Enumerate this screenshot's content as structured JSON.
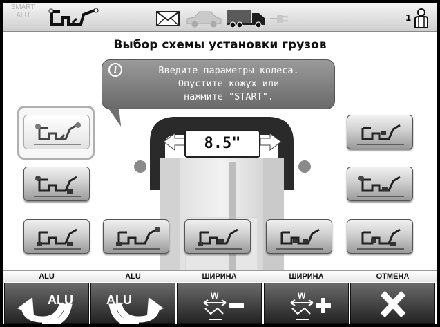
{
  "header": {
    "mode_icon": "balancer-mode-icon",
    "mail_icon": "envelope-icon",
    "car_icon": "car-icon",
    "truck_icon": "truck-icon",
    "plug_icon": "plug-icon",
    "smart_alu_label": "SMART ALU",
    "user_number": "1",
    "user_icon": "operator-icon"
  },
  "title": "Выбор схемы установки грузов",
  "message": {
    "icon": "info-icon",
    "text": "Введите параметры колеса.\nОпустите кожух или\nнажмите \"START\"."
  },
  "wheel": {
    "width_value": "8.5\""
  },
  "schemes": {
    "left": [
      "scheme-1",
      "scheme-2",
      "scheme-3"
    ],
    "bottom": [
      "scheme-4",
      "scheme-5",
      "scheme-6"
    ],
    "right": [
      "scheme-7",
      "scheme-8",
      "scheme-9"
    ],
    "selected": "scheme-1"
  },
  "function_bar": {
    "labels": [
      "ALU",
      "ALU",
      "ШИРИНА",
      "ШИРИНА",
      "ОТМЕНА"
    ],
    "buttons": [
      {
        "icon": "alu-previous-icon",
        "text": "ALU"
      },
      {
        "icon": "alu-next-icon",
        "text": "ALU"
      },
      {
        "icon": "width-decrease-icon",
        "text": "W"
      },
      {
        "icon": "width-increase-icon",
        "text": "W"
      },
      {
        "icon": "cancel-icon",
        "text": ""
      }
    ]
  }
}
